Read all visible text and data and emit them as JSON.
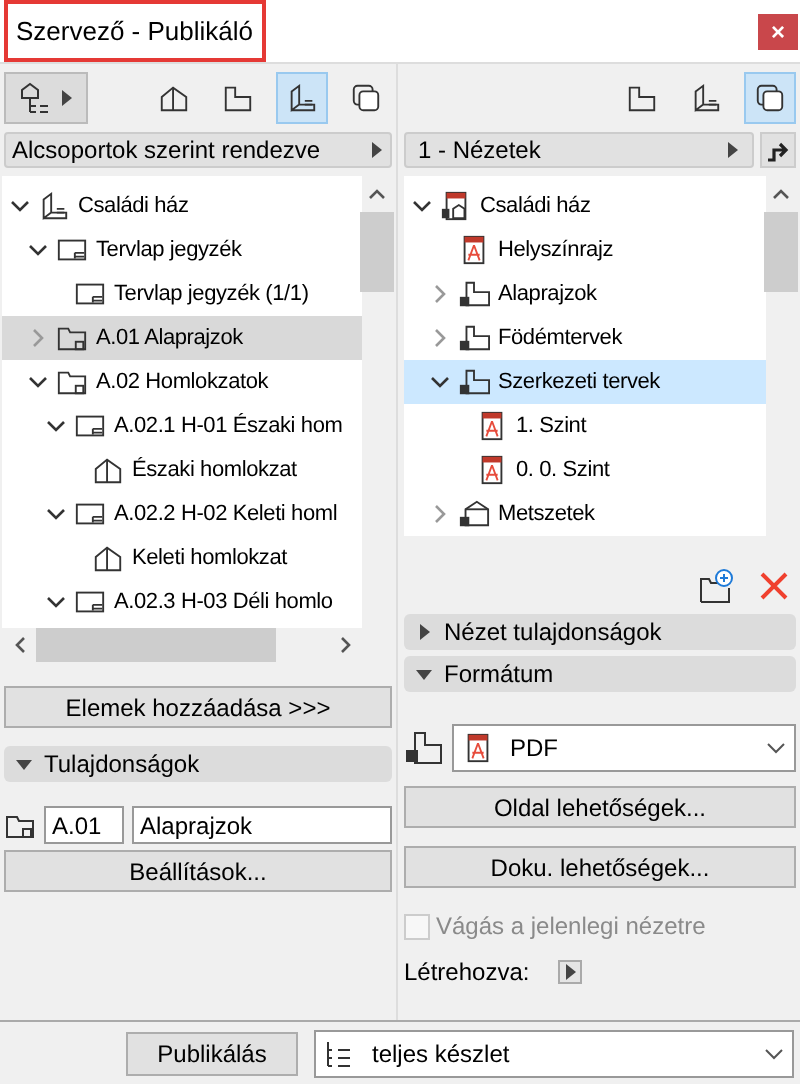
{
  "window": {
    "title": "Szervező - Publikáló",
    "close": "×"
  },
  "left_panel": {
    "view_buttons": [
      {
        "kind": "elevation",
        "selected": false
      },
      {
        "kind": "plan",
        "selected": false
      },
      {
        "kind": "book",
        "selected": true
      },
      {
        "kind": "stack",
        "selected": false
      }
    ],
    "header": "Alcsoportok szerint rendezve",
    "tree": [
      {
        "label": "Családi ház",
        "kind": "book",
        "expanded": true,
        "selected": false,
        "children": [
          {
            "label": "Tervlap jegyzék",
            "kind": "layout",
            "expanded": true,
            "selected": false,
            "children": [
              {
                "label": "Tervlap jegyzék (1/1)",
                "kind": "layout",
                "selected": false
              }
            ]
          },
          {
            "label": "A.01 Alaprajzok",
            "kind": "folder",
            "expanded": false,
            "selected": true
          },
          {
            "label": "A.02 Homlokzatok",
            "kind": "folder",
            "expanded": true,
            "selected": false,
            "children": [
              {
                "label": "A.02.1 H-01 Északi hom",
                "kind": "layout",
                "expanded": true,
                "selected": false,
                "children": [
                  {
                    "label": "Északi homlokzat",
                    "kind": "elevation",
                    "selected": false
                  }
                ]
              },
              {
                "label": "A.02.2 H-02 Keleti homl",
                "kind": "layout",
                "expanded": true,
                "selected": false,
                "children": [
                  {
                    "label": "Keleti homlokzat",
                    "kind": "elevation",
                    "selected": false
                  }
                ]
              },
              {
                "label": "A.02.3 H-03 Déli homlo",
                "kind": "layout",
                "expanded": true,
                "selected": false
              }
            ]
          }
        ]
      }
    ],
    "add_button": "Elemek hozzáadása >>>",
    "properties": {
      "header": "Tulajdonságok",
      "expanded": true,
      "id": "A.01",
      "name": "Alaprajzok",
      "settings_button": "Beállítások..."
    }
  },
  "right_panel": {
    "view_buttons": [
      {
        "kind": "plan",
        "selected": false
      },
      {
        "kind": "book",
        "selected": false
      },
      {
        "kind": "stack",
        "selected": true
      }
    ],
    "header": "1 - Nézetek",
    "tree": [
      {
        "label": "Családi ház",
        "kind": "pdfset",
        "expanded": true,
        "selected": false,
        "children": [
          {
            "label": "Helyszínrajz",
            "kind": "pdf",
            "selected": false
          },
          {
            "label": "Alaprajzok",
            "kind": "viewfolder",
            "expanded": false,
            "selected": false
          },
          {
            "label": "Födémtervek",
            "kind": "viewfolder",
            "expanded": false,
            "selected": false
          },
          {
            "label": "Szerkezeti tervek",
            "kind": "viewfolder",
            "expanded": true,
            "selected": true,
            "children": [
              {
                "label": "1. Szint",
                "kind": "pdf",
                "selected": false
              },
              {
                "label": "0. 0. Szint",
                "kind": "pdf",
                "selected": false
              }
            ]
          },
          {
            "label": "Metszetek",
            "kind": "section",
            "expanded": false,
            "selected": false
          }
        ]
      }
    ],
    "sections": [
      {
        "header": "Nézet tulajdonságok",
        "expanded": false
      },
      {
        "header": "Formátum",
        "expanded": true
      }
    ],
    "format": {
      "value": "PDF",
      "page_button": "Oldal lehetőségek...",
      "doc_button": "Doku. lehetőségek...",
      "crop": {
        "label": "Vágás a jelenlegi nézetre",
        "checked": false,
        "disabled": true
      },
      "created_label": "Létrehozva:"
    }
  },
  "footer": {
    "publish_button": "Publikálás",
    "set": "teljes készlet"
  }
}
